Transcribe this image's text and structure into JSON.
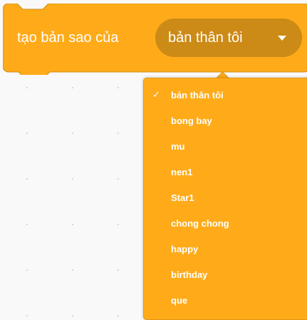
{
  "block": {
    "label": "tạo bản sao của",
    "selected_value": "bản thân tôi",
    "arrow_icon": "caret-down-icon",
    "color": "#ffab19",
    "field_color": "#cc8a16"
  },
  "menu": {
    "check_icon": "checkmark-icon",
    "check_glyph": "✓",
    "items": [
      {
        "label": "bản thân tôi",
        "selected": true
      },
      {
        "label": "bong bay",
        "selected": false
      },
      {
        "label": "mu",
        "selected": false
      },
      {
        "label": "nen1",
        "selected": false
      },
      {
        "label": "Star1",
        "selected": false
      },
      {
        "label": "chong chong",
        "selected": false
      },
      {
        "label": "happy",
        "selected": false
      },
      {
        "label": "birthday",
        "selected": false
      },
      {
        "label": "que",
        "selected": false
      }
    ]
  }
}
